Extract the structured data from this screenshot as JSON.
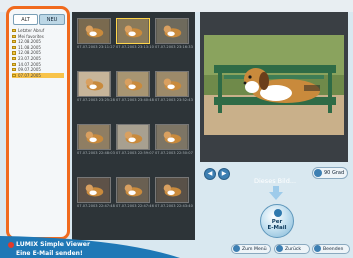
{
  "left_panel": {
    "tabs": [
      "ALT",
      "NEU"
    ],
    "tree": [
      "Letzter Abruf",
      "Mei favorites",
      "12.08.2005",
      "11.08.2005",
      "12.08.2005",
      "23.07.2005",
      "14.07.2005",
      "09.07.2005",
      "07.07.2005"
    ],
    "selected_index": 8
  },
  "thumbnails": {
    "captions": [
      "07.07.2003 23:11:27",
      "07.07.2003 23:13:10",
      "07.07.2003 23:16:33",
      "07.07.2003 23:25:28",
      "07.07.2003 23:40:48",
      "07.07.2003 23:52:43",
      "07.07.2003 22:48:03",
      "07.07.2003 22:59:07",
      "07.07.2003 22:50:07",
      "07.07.2003 22:47:48",
      "07.07.2003 22:47:46",
      "07.07.2003 22:43:40"
    ],
    "selected_index": 1
  },
  "preview": {
    "dieses_label": "Dieses Bild...",
    "rotate_label": "90 Grad",
    "email_line1": "Per",
    "email_line2": "E-Mail"
  },
  "bottom_buttons": {
    "menu": "Zum Menü",
    "back": "Zurück",
    "exit": "Beenden"
  },
  "brand": {
    "line1": "LUMIX Simple Viewer",
    "line2": "Eine E-Mail senden!"
  },
  "colors": {
    "accent": "#f06a1e",
    "button_blue": "#3d7fb2"
  }
}
